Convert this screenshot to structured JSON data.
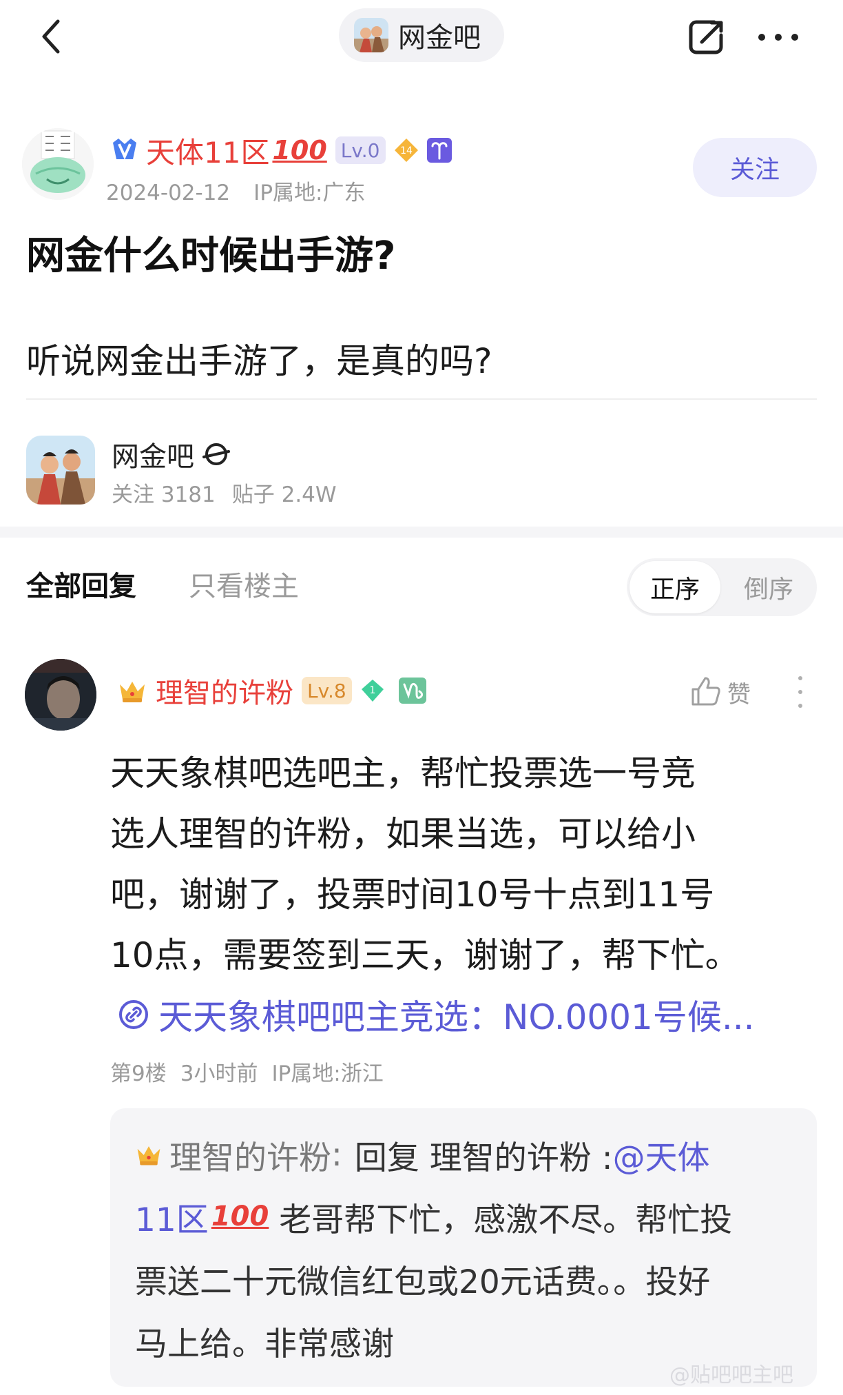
{
  "header": {
    "forum_name": "网金吧"
  },
  "post": {
    "author": {
      "name": "天体11区",
      "hundred_emoji": "💯",
      "level": "Lv.0",
      "fan_badge_level": "14",
      "zodiac_icon": "aries-icon"
    },
    "date": "2024-02-12",
    "ip_location": "IP属地:广东",
    "follow_label": "关注",
    "title": "网金什么时候出手游?",
    "body": "听说网金出手游了，是真的吗?"
  },
  "forum_card": {
    "name": "网金吧",
    "followers": "关注 3181",
    "posts": "贴子 2.4W"
  },
  "tabs": {
    "all_replies": "全部回复",
    "op_only": "只看楼主",
    "sort_asc": "正序",
    "sort_desc": "倒序"
  },
  "reply": {
    "author": {
      "name": "理智的许粉",
      "level": "Lv.8",
      "fan_badge_level": "1",
      "zodiac_icon": "capricorn-icon"
    },
    "like_label": "赞",
    "body_lines": [
      "天天象棋吧选吧主，帮忙投票选一号竞",
      "选人理智的许粉，如果当选，可以给小",
      "吧，谢谢了，投票时间10号十点到11号",
      "10点，需要签到三天，谢谢了，帮下忙。"
    ],
    "link_text": "天天象棋吧吧主竞选：NO.0001号候...",
    "floor": "第9楼",
    "time": "3小时前",
    "ip_location": "IP属地:浙江",
    "sub_reply": {
      "author": "理智的许粉",
      "colon": ":",
      "reply_prefix": "回复 理智的许粉 :",
      "mention_a": "@天体",
      "mention_b": "11区",
      "hundred_emoji": "💯",
      "line2_text": " 老哥帮下忙，感激不尽。帮忙投",
      "line3": "票送二十元微信红包或20元话费。。投好",
      "line4": "马上给。非常感谢"
    }
  },
  "watermark": "@贴吧吧主吧"
}
